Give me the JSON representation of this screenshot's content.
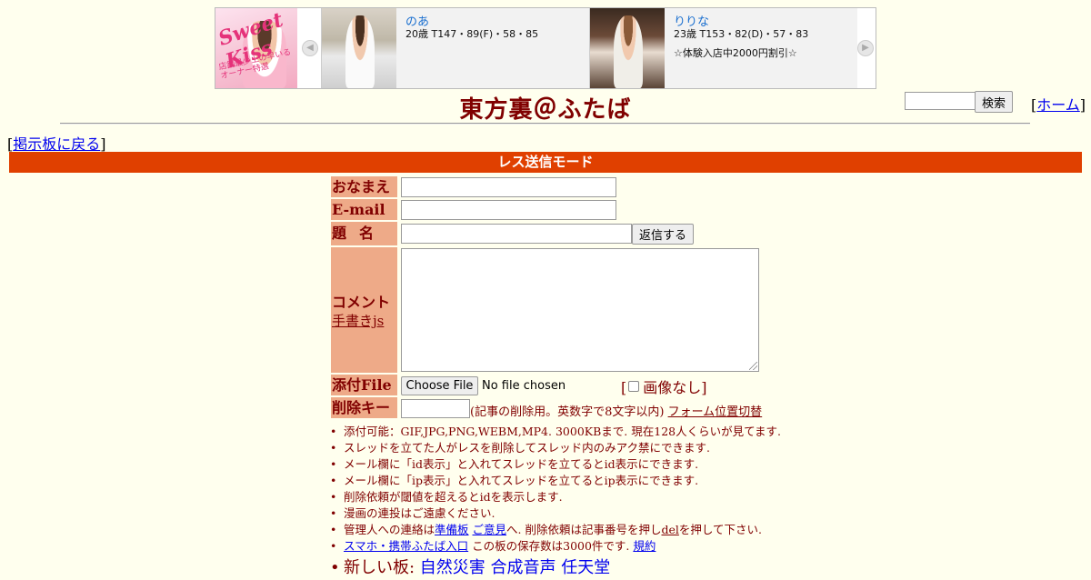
{
  "ads": {
    "logo_text": "Sweet Kiss",
    "logo_sub": "店舗最少上の早いるオーナー特選",
    "cards": [
      {
        "name": "のあ",
        "stats": "20歳 T147・89(F)・58・85",
        "note": ""
      },
      {
        "name": "りりな",
        "stats": "23歳 T153・82(D)・57・83",
        "note": "☆体験入店中2000円割引☆"
      }
    ],
    "prev_icon": "chevron-left-icon",
    "next_icon": "chevron-right-icon"
  },
  "header": {
    "site_title": "東方裏＠ふたば",
    "search_value": "",
    "search_button": "検索",
    "home_bracket_open": "[",
    "home_link": "ホーム",
    "home_bracket_close": "]"
  },
  "nav": {
    "back_bracket_open": "[",
    "back_link": "掲示板に戻る",
    "back_bracket_close": "]"
  },
  "mode_bar": {
    "label": "レス送信モード"
  },
  "form": {
    "name_label": "おなまえ",
    "name_value": "",
    "email_label": "E-mail",
    "email_value": "",
    "subject_label": "題名",
    "subject_value": "",
    "submit_button": "返信する",
    "comment_label": "コメント",
    "comment_link": "手書きjs",
    "comment_value": "",
    "file_label": "添付File",
    "file_button": "Choose File",
    "file_status": "No file chosen",
    "noimg_open": "[",
    "noimg_label": "画像なし",
    "noimg_close": "]",
    "noimg_checked": false,
    "delkey_label": "削除キー",
    "delkey_value": "",
    "delkey_note": "(記事の削除用。英数字で8文字以内)",
    "form_toggle_link": "フォーム位置切替"
  },
  "rules": {
    "r1": "添付可能：GIF,JPG,PNG,WEBM,MP4. 3000KBまで. 現在128人くらいが見てます.",
    "r2": "スレッドを立てた人がレスを削除してスレッド内のみアク禁にできます.",
    "r3": "メール欄に「id表示」と入れてスレッドを立てるとid表示にできます.",
    "r4": "メール欄に「ip表示」と入れてスレッドを立てるとip表示にできます.",
    "r5": "削除依頼が閾値を超えるとidを表示します.",
    "r6": "漫画の連投はご遠慮ください.",
    "r7_pre": "管理人への連絡は",
    "r7_link1": "準備板",
    "r7_space": " ",
    "r7_link2": "ご意見",
    "r7_mid": "へ. 削除依頼は記事番号を押し",
    "r7_link3": "del",
    "r7_post": "を押して下さい.",
    "r8_link": "スマホ・携帯ふたば入口",
    "r8_mid": " この板の保存数は3000件です. ",
    "r8_link2": "規約",
    "r9_pre": "新しい板: ",
    "r9_link1": "自然災害",
    "r9_link2": "合成音声",
    "r9_link3": "任天堂"
  }
}
